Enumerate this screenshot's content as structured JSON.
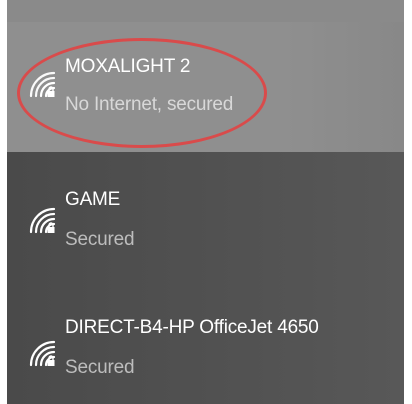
{
  "networks": [
    {
      "name": "MOXALIGHT 2",
      "status": "No Internet, secured",
      "icon": "wifi-secured-icon",
      "selected": true
    },
    {
      "name": "GAME",
      "status": "Secured",
      "icon": "wifi-secured-icon",
      "selected": false
    },
    {
      "name": "DIRECT-B4-HP OfficeJet 4650",
      "status": "Secured",
      "icon": "wifi-secured-icon",
      "selected": false
    }
  ],
  "colors": {
    "panel_background": "#4b4b4b",
    "selected_background": "#8f8f8f",
    "annotation_circle": "#d94b4b",
    "text_primary": "#ffffff",
    "text_secondary": "#d8d8d8"
  }
}
